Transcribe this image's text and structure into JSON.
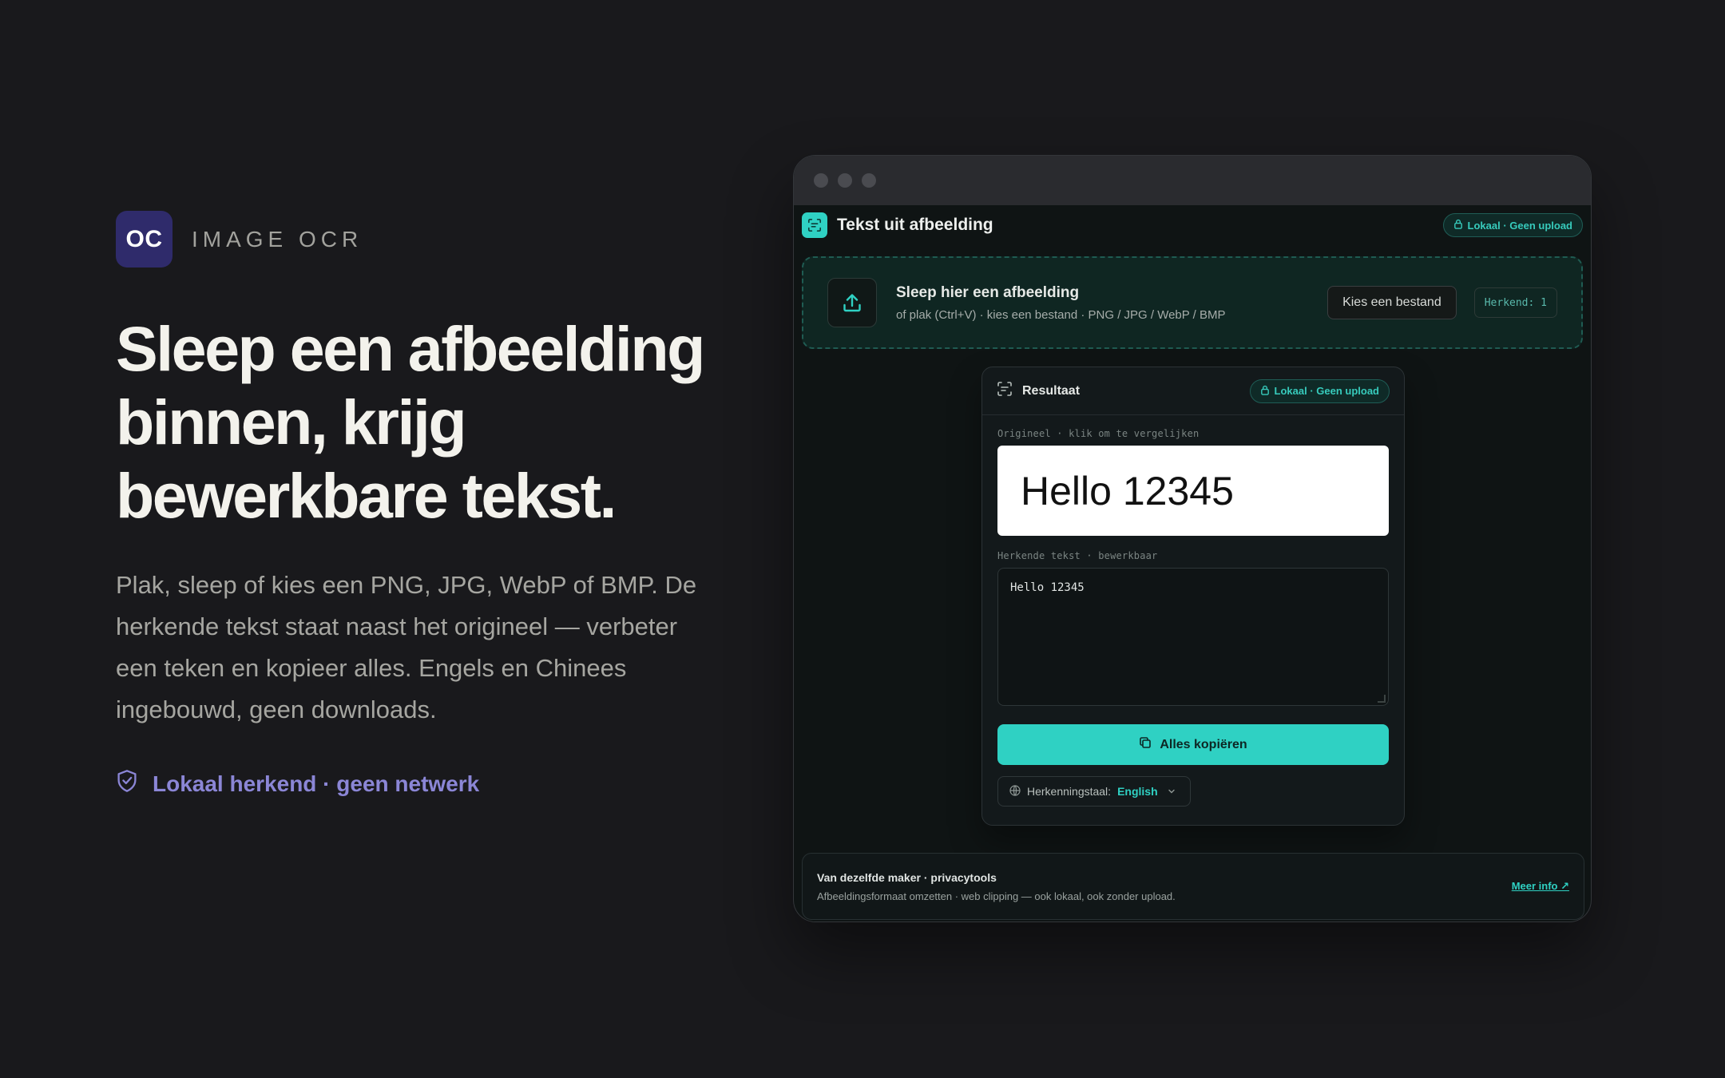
{
  "brand": {
    "logo_text": "OC",
    "name": "IMAGE OCR"
  },
  "hero": {
    "headline": "Sleep een afbeelding binnen, krijg bewerkbare tekst.",
    "lede": "Plak, sleep of kies een PNG, JPG, WebP of BMP. De herkende tekst staat naast het origineel — verbeter een teken en kopieer alles. Engels en Chinees ingebouwd, geen downloads.",
    "trust": "Lokaal herkend · geen netwerk"
  },
  "app": {
    "title": "Tekst uit afbeelding",
    "privacy_badge": "Lokaal · Geen upload",
    "dropzone": {
      "title": "Sleep hier een afbeelding",
      "subtitle": "of plak (Ctrl+V) · kies een bestand · PNG / JPG / WebP / BMP",
      "choose_button": "Kies een bestand",
      "counter": "Herkend: 1"
    },
    "result": {
      "title": "Resultaat",
      "badge": "Lokaal · Geen upload",
      "original_label": "Origineel · klik om te vergelijken",
      "original_text": "Hello 12345",
      "recognized_label": "Herkende tekst · bewerkbaar",
      "recognized_text": "Hello 12345",
      "copy_button": "Alles kopiëren",
      "language_label": "Herkenningstaal:",
      "language_value": "English"
    },
    "footer": {
      "title": "Van dezelfde maker · privacytools",
      "subtitle": "Afbeeldingsformaat omzetten · web clipping — ook lokaal, ook zonder upload.",
      "link": "Meer info ↗"
    }
  },
  "colors": {
    "background": "#19191c",
    "accent": "#2fd1c3",
    "brand": "#2f2b6b",
    "trust": "#8b86d6"
  },
  "icons": [
    "shield-check-icon",
    "scan-icon",
    "lock-icon",
    "upload-icon",
    "copy-icon",
    "globe-icon",
    "chevron-down-icon"
  ]
}
